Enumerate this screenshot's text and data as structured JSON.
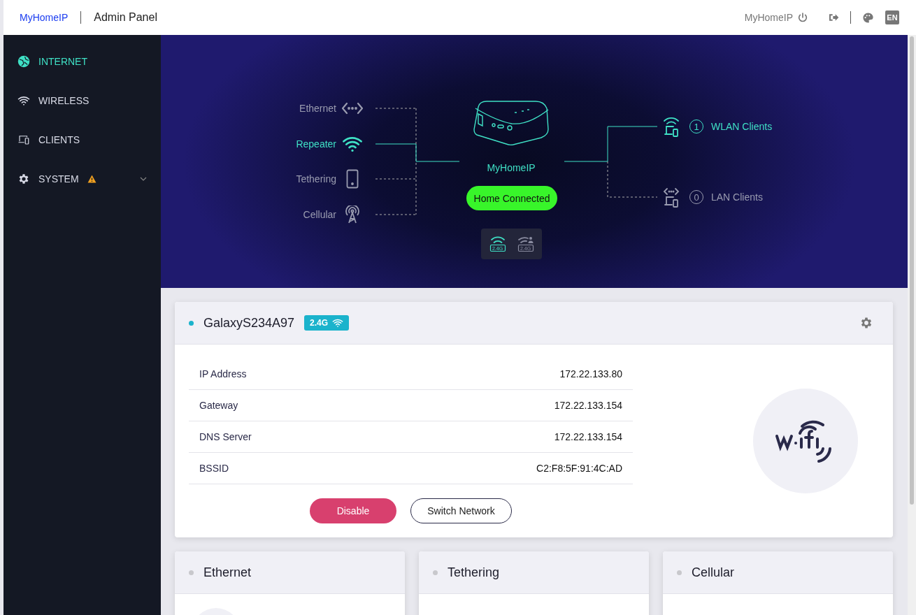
{
  "header": {
    "brand": "MyHomeIP",
    "title": "Admin Panel",
    "device": "MyHomeIP",
    "language": "EN"
  },
  "sidebar": {
    "items": [
      {
        "label": "INTERNET",
        "kind": "globe",
        "selected": true,
        "warning": false,
        "expandable": false
      },
      {
        "label": "WIRELESS",
        "kind": "wifi",
        "selected": false,
        "warning": false,
        "expandable": false
      },
      {
        "label": "CLIENTS",
        "kind": "devices",
        "selected": false,
        "warning": false,
        "expandable": false
      },
      {
        "label": "SYSTEM",
        "kind": "gear",
        "selected": false,
        "warning": true,
        "expandable": true
      }
    ]
  },
  "topology": {
    "sources": [
      {
        "label": "Ethernet",
        "kind": "ethernet",
        "selected": false
      },
      {
        "label": "Repeater",
        "kind": "wifi",
        "selected": true
      },
      {
        "label": "Tethering",
        "kind": "phone",
        "selected": false
      },
      {
        "label": "Cellular",
        "kind": "cellular",
        "selected": false
      }
    ],
    "router": "MyHomeIP",
    "status": "Home Connected",
    "bands": [
      {
        "label": "2.4G",
        "kind": "wifi",
        "active": true
      },
      {
        "label": "2.4G",
        "kind": "guest",
        "active": false
      }
    ],
    "clients": [
      {
        "count": "1",
        "label": "WLAN Clients",
        "kind": "wlan",
        "active": true
      },
      {
        "count": "0",
        "label": "LAN Clients",
        "kind": "lan",
        "active": false
      }
    ]
  },
  "connection": {
    "name": "GalaxyS234A97",
    "active": true,
    "band": "2.4G",
    "rows": [
      {
        "label": "IP Address",
        "value": "172.22.133.80"
      },
      {
        "label": "Gateway",
        "value": "172.22.133.154"
      },
      {
        "label": "DNS Server",
        "value": "172.22.133.154"
      },
      {
        "label": "BSSID",
        "value": "C2:F8:5F:91:4C:AD"
      }
    ],
    "buttons": [
      {
        "label": "Disable",
        "kind": "danger"
      },
      {
        "label": "Switch Network",
        "kind": "outline"
      }
    ]
  },
  "cards": [
    {
      "title": "Ethernet",
      "active": false
    },
    {
      "title": "Tethering",
      "active": false
    },
    {
      "title": "Cellular",
      "active": false
    }
  ]
}
